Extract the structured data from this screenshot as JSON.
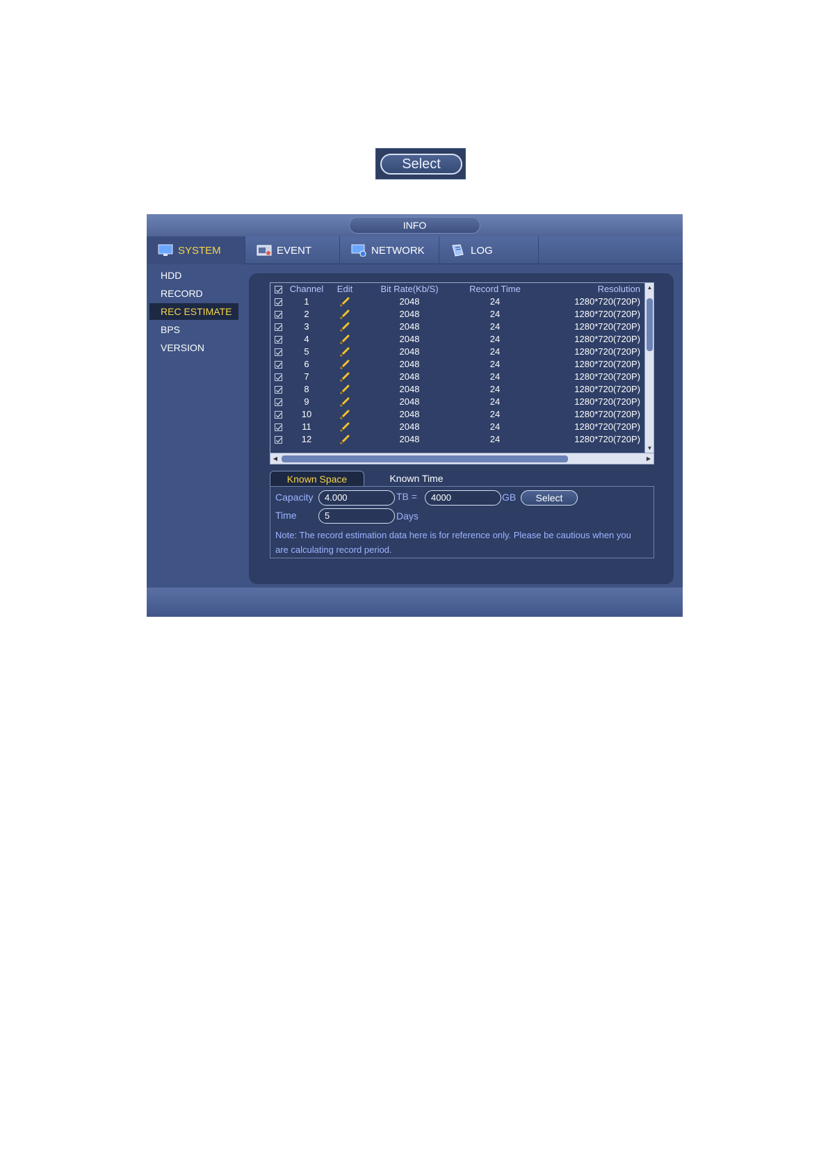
{
  "top_button": {
    "label": "Select"
  },
  "window": {
    "title": "INFO",
    "tabs": [
      {
        "label": "SYSTEM",
        "icon": "monitor-icon",
        "active": true
      },
      {
        "label": "EVENT",
        "icon": "event-icon",
        "active": false
      },
      {
        "label": "NETWORK",
        "icon": "network-icon",
        "active": false
      },
      {
        "label": "LOG",
        "icon": "log-book-icon",
        "active": false
      }
    ],
    "sidebar": [
      {
        "label": "HDD",
        "active": false
      },
      {
        "label": "RECORD",
        "active": false
      },
      {
        "label": "REC ESTIMATE",
        "active": true
      },
      {
        "label": "BPS",
        "active": false
      },
      {
        "label": "VERSION",
        "active": false
      }
    ]
  },
  "table": {
    "headers": {
      "channel": "Channel",
      "edit": "Edit",
      "bitrate": "Bit Rate(Kb/S)",
      "record_time": "Record Time",
      "resolution": "Resolution"
    },
    "rows": [
      {
        "channel": "1",
        "bitrate": "2048",
        "record_time": "24",
        "resolution": "1280*720(720P)"
      },
      {
        "channel": "2",
        "bitrate": "2048",
        "record_time": "24",
        "resolution": "1280*720(720P)"
      },
      {
        "channel": "3",
        "bitrate": "2048",
        "record_time": "24",
        "resolution": "1280*720(720P)"
      },
      {
        "channel": "4",
        "bitrate": "2048",
        "record_time": "24",
        "resolution": "1280*720(720P)"
      },
      {
        "channel": "5",
        "bitrate": "2048",
        "record_time": "24",
        "resolution": "1280*720(720P)"
      },
      {
        "channel": "6",
        "bitrate": "2048",
        "record_time": "24",
        "resolution": "1280*720(720P)"
      },
      {
        "channel": "7",
        "bitrate": "2048",
        "record_time": "24",
        "resolution": "1280*720(720P)"
      },
      {
        "channel": "8",
        "bitrate": "2048",
        "record_time": "24",
        "resolution": "1280*720(720P)"
      },
      {
        "channel": "9",
        "bitrate": "2048",
        "record_time": "24",
        "resolution": "1280*720(720P)"
      },
      {
        "channel": "10",
        "bitrate": "2048",
        "record_time": "24",
        "resolution": "1280*720(720P)"
      },
      {
        "channel": "11",
        "bitrate": "2048",
        "record_time": "24",
        "resolution": "1280*720(720P)"
      },
      {
        "channel": "12",
        "bitrate": "2048",
        "record_time": "24",
        "resolution": "1280*720(720P)"
      }
    ]
  },
  "estimate": {
    "tabs": {
      "known_space": "Known Space",
      "known_time": "Known Time"
    },
    "capacity_label": "Capacity",
    "capacity_tb": "4.000",
    "tb_eq": "TB =",
    "capacity_gb": "4000",
    "gb_unit": "GB",
    "select_label": "Select",
    "time_label": "Time",
    "time_value": "5",
    "days_unit": "Days",
    "note": "Note: The record estimation data here is for reference only. Please be cautious when you are calculating record period."
  },
  "colors": {
    "accent": "#f7d54a",
    "label_blue": "#9fb4ff",
    "panel": "#2d3d64"
  }
}
